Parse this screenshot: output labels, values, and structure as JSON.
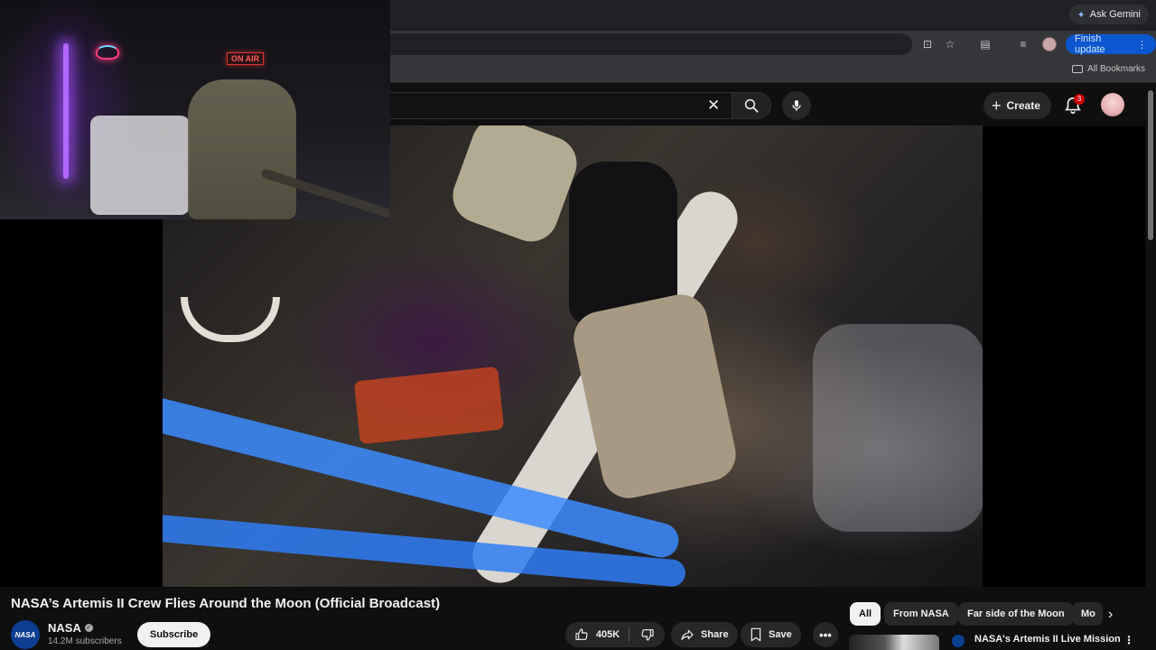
{
  "browser": {
    "ask_gemini": "Ask Gemini",
    "finish_update": "Finish update",
    "all_bookmarks": "All Bookmarks"
  },
  "header": {
    "create_label": "Create",
    "notification_count": "3"
  },
  "webcam": {
    "on_air_sign": "ON AIR"
  },
  "video": {
    "title": "NASA’s Artemis II Crew Flies Around the Moon (Official Broadcast)"
  },
  "channel": {
    "name": "NASA",
    "avatar_text": "NASA",
    "subscribers": "14.2M subscribers",
    "subscribe_label": "Subscribe"
  },
  "actions": {
    "likes": "405K",
    "share_label": "Share",
    "save_label": "Save"
  },
  "chips": [
    {
      "label": "All",
      "active": true
    },
    {
      "label": "From NASA",
      "active": false
    },
    {
      "label": "Far side of the Moon",
      "active": false
    },
    {
      "label": "Mo",
      "active": false
    }
  ],
  "recommendation": {
    "title": "NASA's Artemis II Live Mission"
  },
  "colors": {
    "accent": "#0b57d0",
    "badge": "#cc0000",
    "background": "#0f0f0f"
  }
}
